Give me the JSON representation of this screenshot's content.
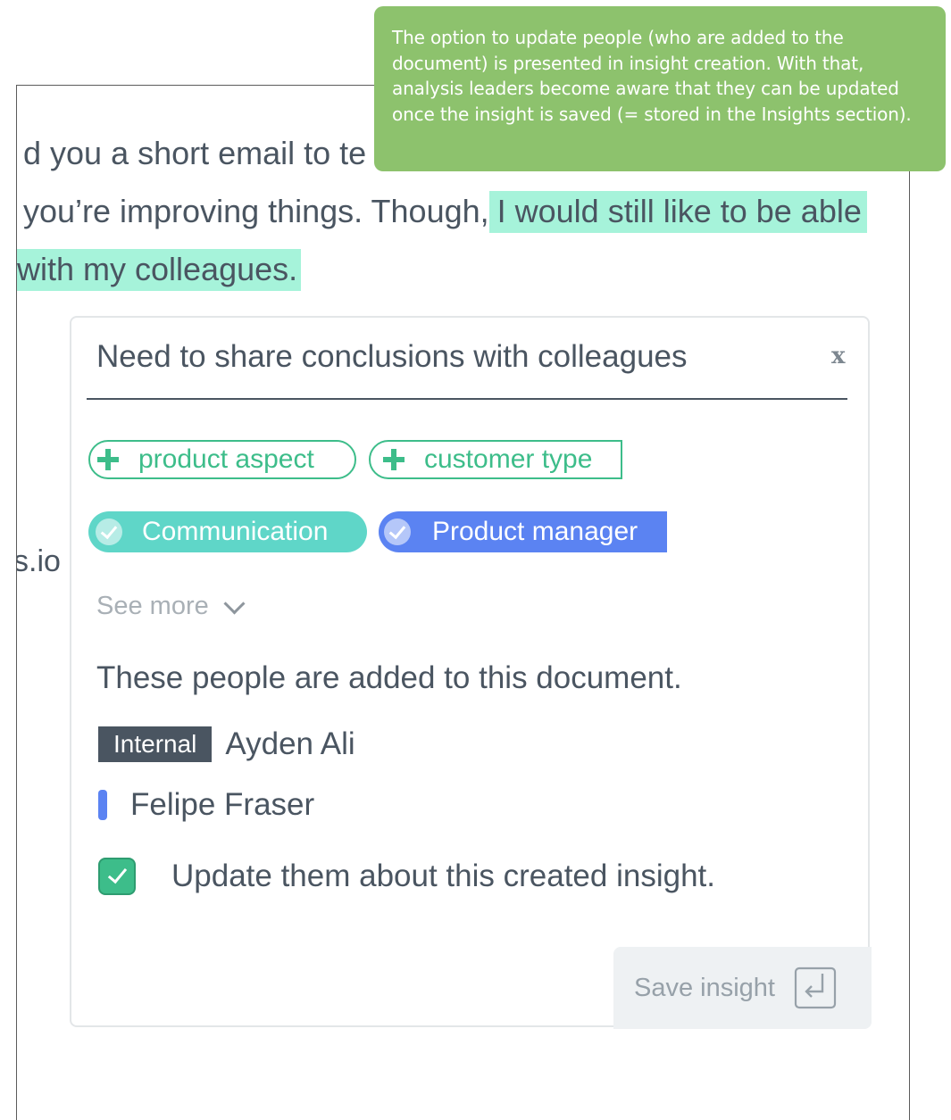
{
  "tooltip": {
    "text": "The option to update people (who are added to the document) is presented in insight creation. With that, analysis leaders become aware that they can be updated once the insight is saved (= stored in the Insights section)."
  },
  "document": {
    "line1": "d you a short email to te",
    "line2_plain": "you’re improving things. Though,",
    "line2_highlight": "I would still like to be able",
    "line3_highlight": "with my colleagues.",
    "line4": "s.io"
  },
  "insight_card": {
    "title": "Need to share conclusions with colleagues",
    "close_label": "x",
    "add_tags": [
      {
        "label": "product aspect"
      },
      {
        "label": "customer type"
      }
    ],
    "selected_tags": [
      {
        "label": "Communication",
        "color": "#5fd6c8"
      },
      {
        "label": "Product manager",
        "color": "#5b83f2"
      }
    ],
    "see_more": "See more",
    "people_heading": "These people are added to this document.",
    "people": [
      {
        "badge": "Internal",
        "name": "Ayden Ali"
      },
      {
        "name": "Felipe Fraser",
        "marker_color": "#5b83f2"
      }
    ],
    "update_checkbox": {
      "checked": true,
      "label": "Update them about this created insight."
    },
    "save_button": {
      "label": "Save insight",
      "icon": "enter-icon"
    }
  },
  "colors": {
    "tooltip_bg": "#8dc26d",
    "highlight": "#a6f3da",
    "accent_green": "#3dbd8a",
    "text": "#4a5561"
  }
}
